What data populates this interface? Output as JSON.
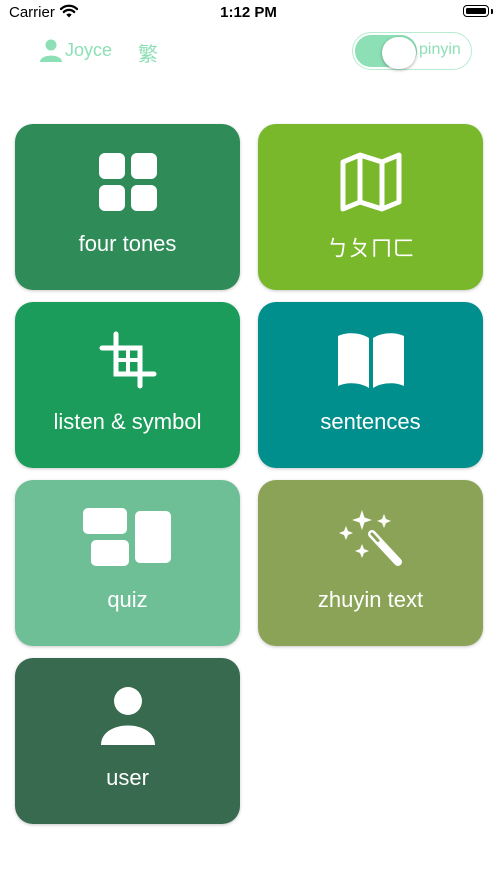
{
  "status_bar": {
    "carrier": "Carrier",
    "time": "1:12 PM"
  },
  "header": {
    "user_name": "Joyce",
    "script_toggle": "繁",
    "pinyin_label": "pinyin",
    "pinyin_on": true
  },
  "colors": {
    "accent": "#8de0b6",
    "four_tones": "#2f8b57",
    "bopomofo": "#78b82a",
    "listen_symbol": "#1b9c5b",
    "sentences": "#008f8c",
    "quiz": "#6fbf96",
    "zhuyin_text": "#8ba357",
    "user": "#376a4e"
  },
  "tiles": [
    {
      "label": "four tones",
      "icon": "grid-icon"
    },
    {
      "label": "ㄅㄆㄇㄈ",
      "icon": "map-icon"
    },
    {
      "label": "listen & symbol",
      "icon": "crop-icon"
    },
    {
      "label": "sentences",
      "icon": "book-icon"
    },
    {
      "label": "quiz",
      "icon": "rectangles-icon"
    },
    {
      "label": "zhuyin text",
      "icon": "magic-wand-icon"
    },
    {
      "label": "user",
      "icon": "person-icon"
    }
  ]
}
